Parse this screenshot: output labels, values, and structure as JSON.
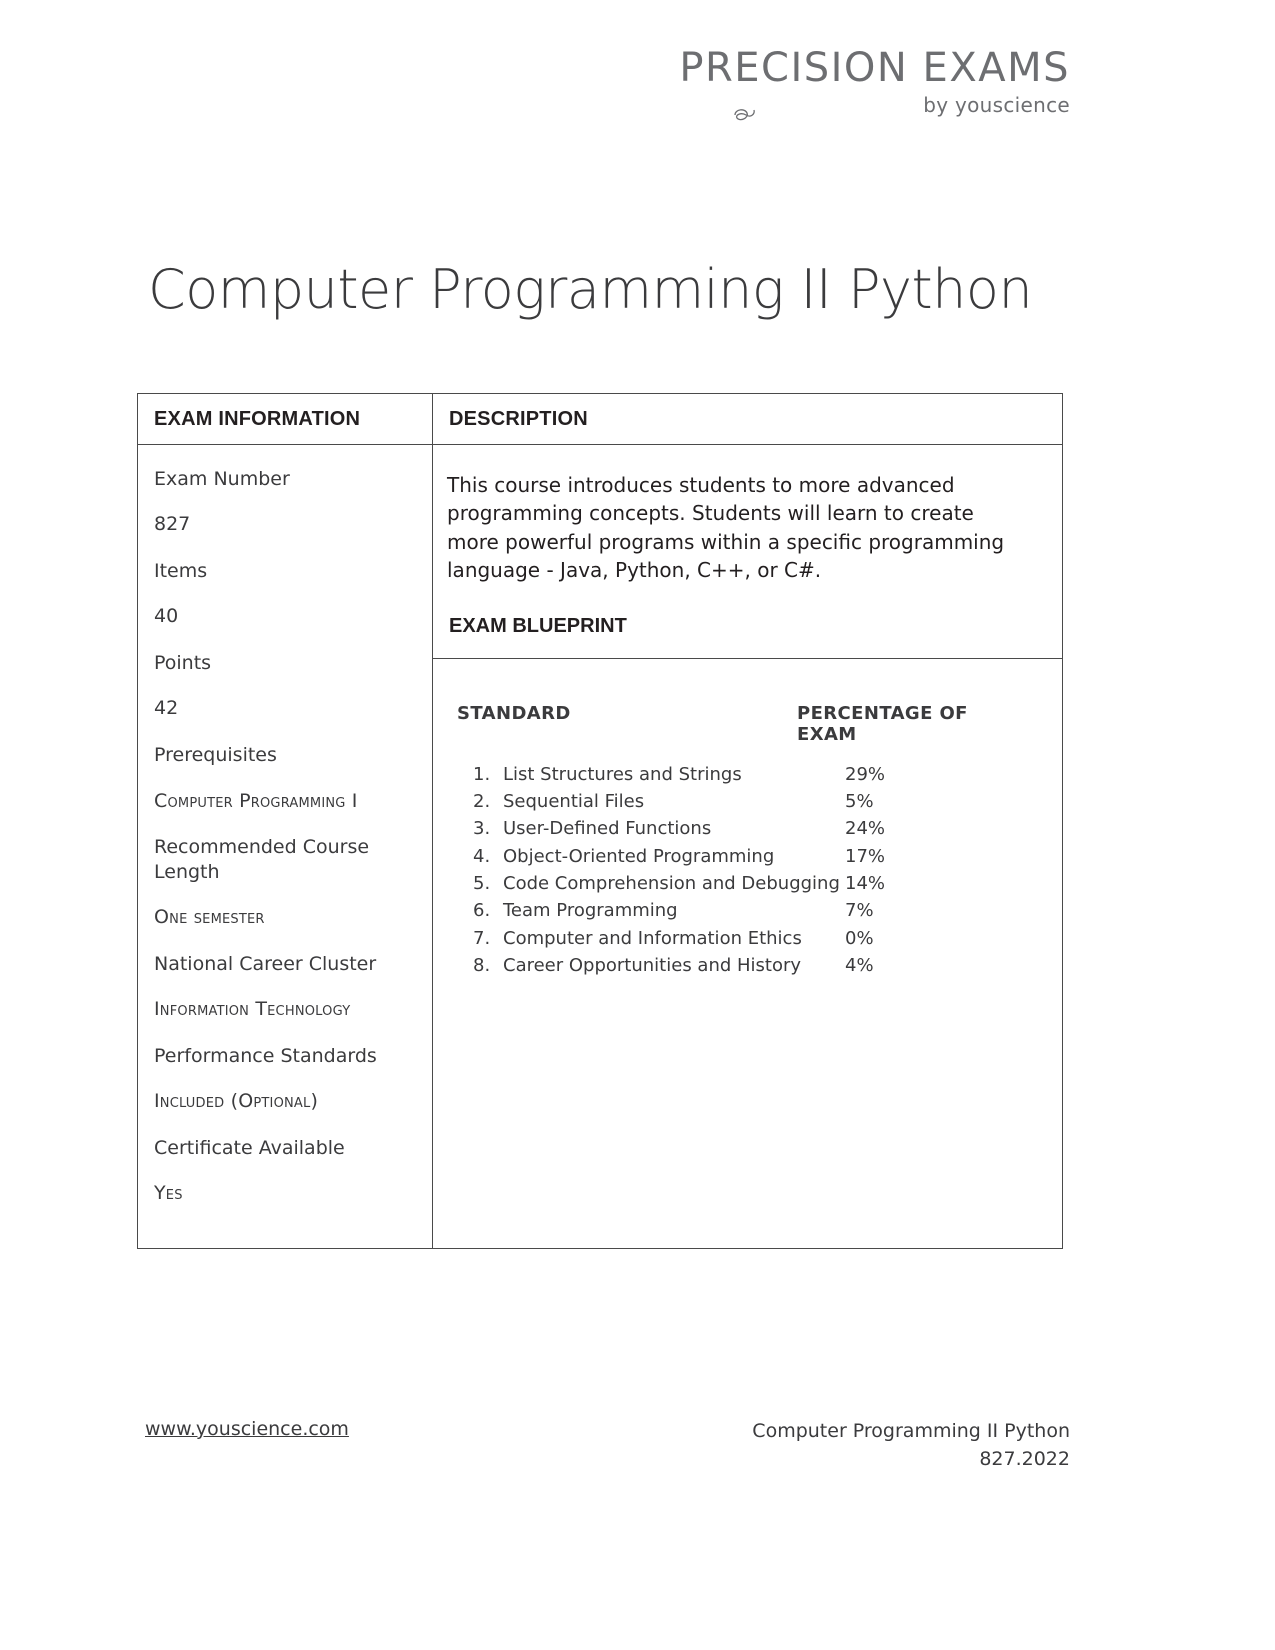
{
  "logo": {
    "main": "PRECISION EXAMS",
    "sub": "by youscience"
  },
  "title": "Computer Programming II Python",
  "table": {
    "header_left": "EXAM INFORMATION",
    "header_right": "DESCRIPTION",
    "exam_information": [
      {
        "label": "Exam Number",
        "value": "827",
        "smallcaps": false
      },
      {
        "label": "Items",
        "value": "40",
        "smallcaps": false
      },
      {
        "label": "Points",
        "value": "42",
        "smallcaps": false
      },
      {
        "label": "Prerequisites",
        "value": "Computer Programming I",
        "smallcaps": true
      },
      {
        "label": "Recommended Course Length",
        "value": "One semester",
        "smallcaps": true
      },
      {
        "label": "National Career Cluster",
        "value": "Information Technology",
        "smallcaps": true
      },
      {
        "label": "Performance Standards",
        "value": "Included (Optional)",
        "smallcaps": true
      },
      {
        "label": "Certificate Available",
        "value": "Yes",
        "smallcaps": true
      }
    ],
    "description": "This course introduces students to more advanced programming concepts. Students will learn to create more powerful programs within a specific programming language - Java, Python, C++, or C#.",
    "blueprint_title": "EXAM BLUEPRINT",
    "blueprint": {
      "col_standard": "STANDARD",
      "col_percentage": "PERCENTAGE OF EXAM",
      "rows": [
        {
          "num": "1.",
          "name": "List Structures and Strings",
          "pct": "29%"
        },
        {
          "num": "2.",
          "name": "Sequential Files",
          "pct": "5%"
        },
        {
          "num": "3.",
          "name": "User-Defined Functions",
          "pct": "24%"
        },
        {
          "num": "4.",
          "name": "Object-Oriented Programming",
          "pct": "17%"
        },
        {
          "num": "5.",
          "name": "Code Comprehension and Debugging",
          "pct": "14%"
        },
        {
          "num": "6.",
          "name": "Team Programming",
          "pct": "7%"
        },
        {
          "num": "7.",
          "name": "Computer and Information Ethics",
          "pct": "0%"
        },
        {
          "num": "8.",
          "name": "Career Opportunities and History",
          "pct": "4%"
        }
      ]
    }
  },
  "footer": {
    "link": "www.youscience.com",
    "doc_title": "Computer Programming II Python",
    "doc_code": "827.2022"
  }
}
